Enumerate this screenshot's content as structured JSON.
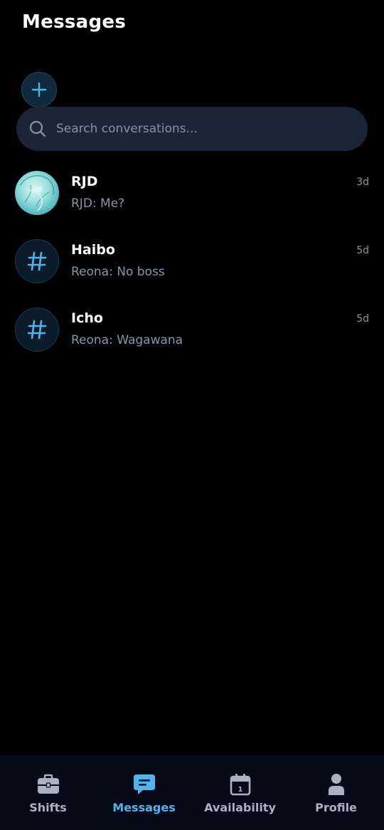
{
  "header": {
    "title": "Messages"
  },
  "search": {
    "placeholder": "Search conversations..."
  },
  "conversations": [
    {
      "name": "RJD",
      "preview": "RJD: Me?",
      "time": "3d",
      "avatar": "image-avatar"
    },
    {
      "name": "Haibo",
      "preview": "Reona: No boss",
      "time": "5d",
      "avatar": "hash-icon"
    },
    {
      "name": "Icho",
      "preview": "Reona: Wagawana",
      "time": "5d",
      "avatar": "hash-icon"
    }
  ],
  "bottom_nav": {
    "items": [
      {
        "label": "Shifts",
        "icon": "briefcase-icon",
        "active": false
      },
      {
        "label": "Messages",
        "icon": "message-icon",
        "active": true
      },
      {
        "label": "Availability",
        "icon": "calendar-icon",
        "calendar_day": "1",
        "active": false
      },
      {
        "label": "Profile",
        "icon": "person-icon",
        "active": false
      }
    ]
  },
  "colors": {
    "accent": "#4fb3ec",
    "background": "#000000",
    "search_background": "#1c2535",
    "nav_background": "#050a16",
    "muted_text": "#8b95a8"
  }
}
